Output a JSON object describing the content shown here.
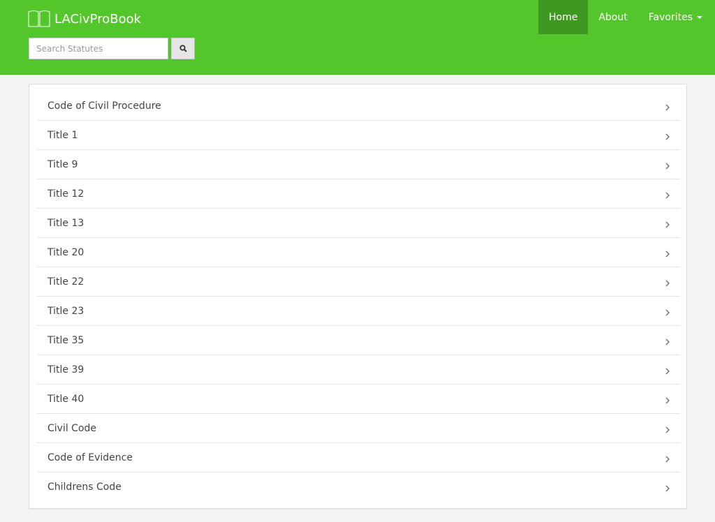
{
  "brand": {
    "icon": "book-open-icon",
    "name": "LACivProBook"
  },
  "search": {
    "placeholder": "Search Statutes",
    "value": "",
    "button_icon": "search-icon"
  },
  "nav": {
    "home": "Home",
    "about": "About",
    "favorites": "Favorites",
    "active": "Home"
  },
  "colors": {
    "navbar": "#53c62c",
    "nav_active": "#3d9920",
    "page_bg": "#f4f4f4"
  },
  "items": [
    {
      "label": "Code of Civil Procedure",
      "icon": "chevron-right-icon"
    },
    {
      "label": "Title 1",
      "icon": "chevron-right-icon"
    },
    {
      "label": "Title 9",
      "icon": "chevron-right-icon"
    },
    {
      "label": "Title 12",
      "icon": "chevron-right-icon"
    },
    {
      "label": "Title 13",
      "icon": "chevron-right-icon"
    },
    {
      "label": "Title 20",
      "icon": "chevron-right-icon"
    },
    {
      "label": "Title 22",
      "icon": "chevron-right-icon"
    },
    {
      "label": "Title 23",
      "icon": "chevron-right-icon"
    },
    {
      "label": "Title 35",
      "icon": "chevron-right-icon"
    },
    {
      "label": "Title 39",
      "icon": "chevron-right-icon"
    },
    {
      "label": "Title 40",
      "icon": "chevron-right-icon"
    },
    {
      "label": "Civil Code",
      "icon": "chevron-right-icon"
    },
    {
      "label": "Code of Evidence",
      "icon": "chevron-right-icon"
    },
    {
      "label": "Childrens Code",
      "icon": "chevron-right-icon"
    }
  ]
}
